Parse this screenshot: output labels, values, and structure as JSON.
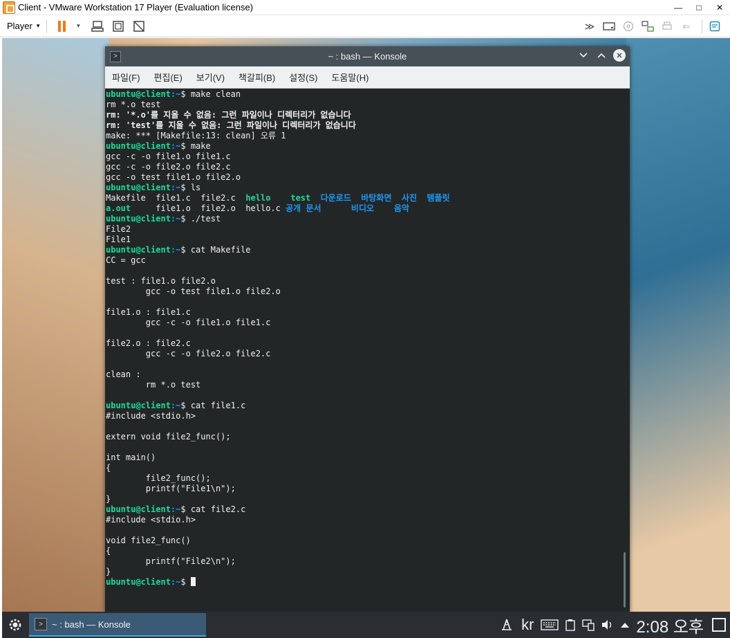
{
  "host": {
    "title": "Client - VMware Workstation 17 Player (Evaluation license)",
    "minimize": "—",
    "maximize": "□",
    "close": "✕",
    "player_label": "Player",
    "caret": "▾",
    "icons": [
      "send-cad-icon",
      "fit-guest-icon",
      "unity-icon"
    ],
    "right_icons": [
      "more-chevron-icon",
      "hdd-icon",
      "cd-icon",
      "network-icon",
      "printer-icon",
      "usb-icon",
      "notes-icon"
    ]
  },
  "konsole": {
    "title": "~ : bash — Konsole",
    "menu": [
      "파일(F)",
      "편집(E)",
      "보기(V)",
      "책갈피(B)",
      "설정(S)",
      "도움말(H)"
    ],
    "prompt_user": "ubuntu@client",
    "prompt_path": ":~",
    "prompt_sign": "$ ",
    "cmd": {
      "make_clean": "make clean",
      "make": "make",
      "ls": "ls",
      "run": "./test",
      "cat_makefile": "cat Makefile",
      "cat_file1": "cat file1.c",
      "cat_file2": "cat file2.c"
    },
    "out": {
      "rm_cmd": "rm *.o test",
      "rm_err1": "rm: '*.o'를 지울 수 없음: 그런 파일이나 디렉터리가 없습니다",
      "rm_err2": "rm: 'test'를 지울 수 없음: 그런 파일이나 디렉터리가 없습니다",
      "make_err": "make: *** [Makefile:13: clean] 오류 1",
      "gcc1": "gcc -c -o file1.o file1.c",
      "gcc2": "gcc -c -o file2.o file2.c",
      "gcc3": "gcc -o test file1.o file2.o",
      "ls_row1": [
        "Makefile",
        "file1.c",
        "file2.c",
        "hello",
        "test",
        "다운로드",
        "바탕화면",
        "사진",
        "템플릿"
      ],
      "ls_row2": [
        "a.out",
        "file1.o",
        "file2.o",
        "hello.c",
        "공개",
        "문서",
        "비디오",
        "음악"
      ],
      "run1": "File2",
      "run2": "File1",
      "mk1": "CC = gcc",
      "mk2": "test : file1.o file2.o",
      "mk3": "        gcc -o test file1.o file2.o",
      "mk4": "file1.o : file1.c",
      "mk5": "        gcc -c -o file1.o file1.c",
      "mk6": "file2.o : file2.c",
      "mk7": "        gcc -c -o file2.o file2.c",
      "mk8": "clean :",
      "mk9": "        rm *.o test",
      "f1_1": "#include <stdio.h>",
      "f1_2": "extern void file2_func();",
      "f1_3": "int main()",
      "f1_4": "{",
      "f1_5": "        file2_func();",
      "f1_6": "        printf(\"File1\\n\");",
      "f1_7": "}",
      "f2_1": "#include <stdio.h>",
      "f2_2": "void file2_func()",
      "f2_3": "{",
      "f2_4": "        printf(\"File2\\n\");",
      "f2_5": "}"
    }
  },
  "taskbar": {
    "task_label": "~ : bash — Konsole",
    "lang": "kr",
    "clock": "2:08 오후",
    "tray_icons": [
      "network-manager-icon",
      "keyboard-icon",
      "clipboard-icon",
      "display-icon",
      "volume-icon",
      "expand-tray-icon"
    ]
  }
}
